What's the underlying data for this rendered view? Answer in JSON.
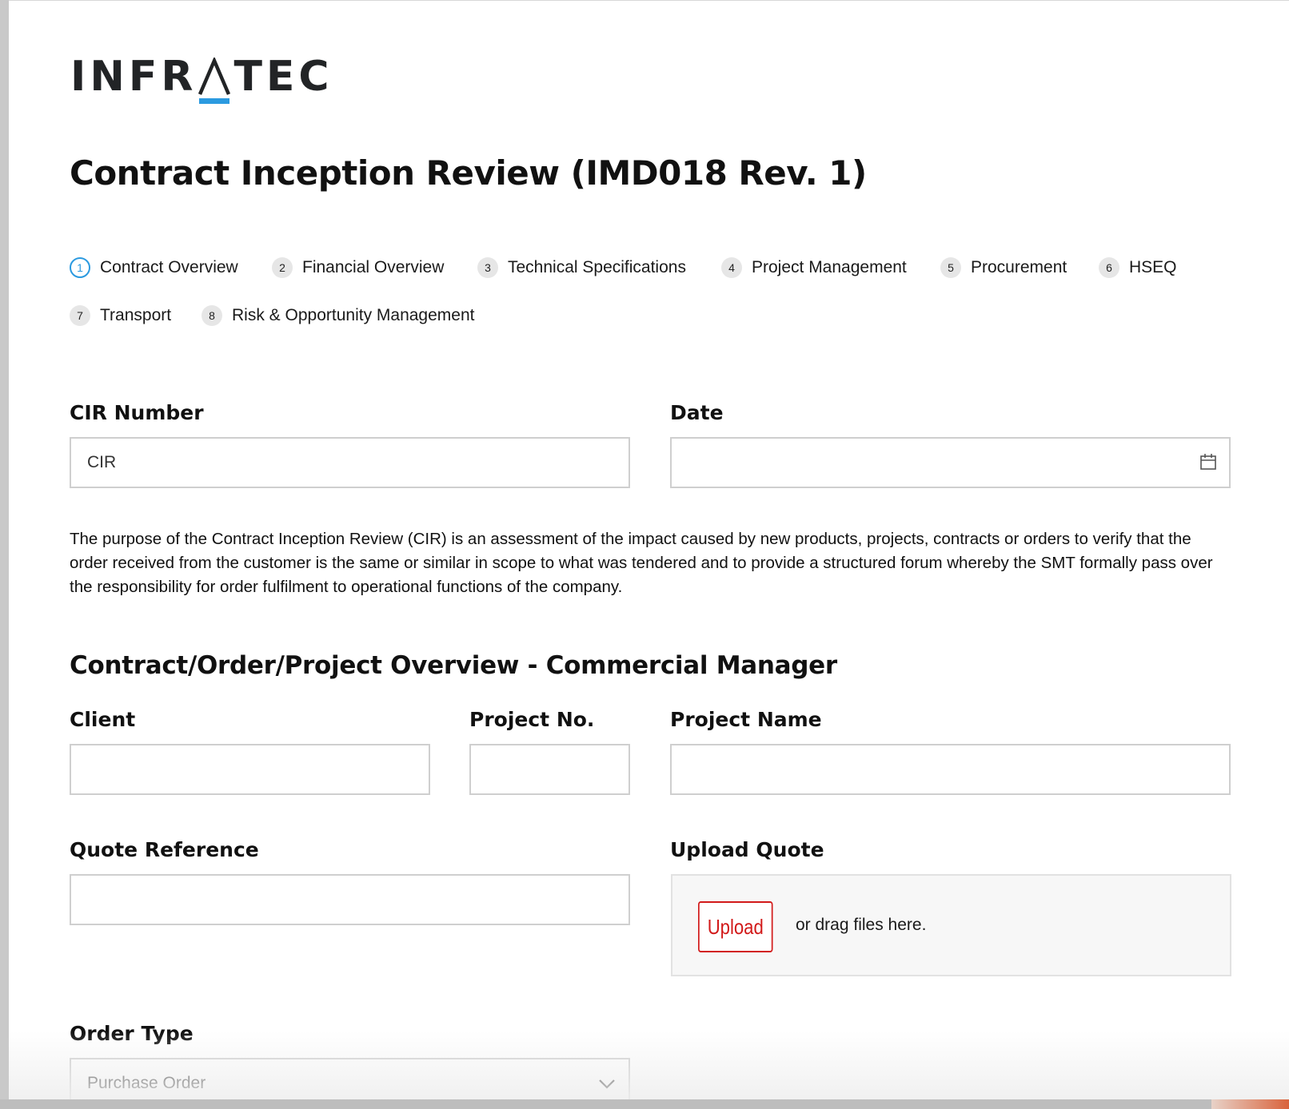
{
  "logo": {
    "text_left": "INFR",
    "text_right": "TEC",
    "mark_color": "#2b9ae0"
  },
  "page": {
    "title": "Contract Inception Review (IMD018 Rev. 1)"
  },
  "steps": [
    {
      "num": "1",
      "label": "Contract Overview",
      "active": true
    },
    {
      "num": "2",
      "label": "Financial Overview"
    },
    {
      "num": "3",
      "label": "Technical Specifications"
    },
    {
      "num": "4",
      "label": "Project Management"
    },
    {
      "num": "5",
      "label": "Procurement"
    },
    {
      "num": "6",
      "label": "HSEQ"
    },
    {
      "num": "7",
      "label": "Transport"
    },
    {
      "num": "8",
      "label": "Risk & Opportunity Management"
    }
  ],
  "fields": {
    "cir_number": {
      "label": "CIR Number",
      "value": "CIR"
    },
    "date": {
      "label": "Date",
      "value": "",
      "icon": "calendar-icon"
    },
    "client": {
      "label": "Client",
      "value": ""
    },
    "project_no": {
      "label": "Project No.",
      "value": ""
    },
    "project_name": {
      "label": "Project Name",
      "value": ""
    },
    "quote_reference": {
      "label": "Quote Reference",
      "value": ""
    },
    "upload_quote": {
      "label": "Upload Quote",
      "button": "Upload",
      "hint": "or drag files here."
    },
    "order_type": {
      "label": "Order Type",
      "value": "Purchase Order",
      "icon": "chevron-down-icon"
    }
  },
  "description": "The purpose of the Contract Inception Review (CIR) is an assessment of the impact caused by new products, projects, contracts or orders to verify that the order received from the customer is the same or similar in scope to what was tendered and to provide a structured forum whereby the SMT formally pass over the responsibility for order fulfilment to operational functions of the company.",
  "section": {
    "heading": "Contract/Order/Project Overview - Commercial Manager"
  },
  "colors": {
    "accent_blue": "#2b9ae0",
    "upload_red": "#d21a1a",
    "input_border": "#cfcfcf"
  }
}
